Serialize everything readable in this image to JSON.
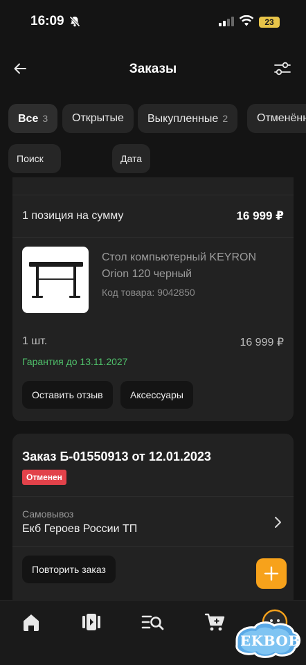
{
  "status_bar": {
    "time": "16:09",
    "battery": "23"
  },
  "header": {
    "title": "Заказы"
  },
  "filters": {
    "chips": [
      {
        "label": "Все",
        "count": "3"
      },
      {
        "label": "Открытые",
        "count": ""
      },
      {
        "label": "Выкупленные",
        "count": "2"
      },
      {
        "label": "Отменённые",
        "count": ""
      }
    ],
    "search_label": "Поиск по заказам",
    "date_label": "Дата"
  },
  "order_1": {
    "summary_label": "1 позиция на сумму",
    "summary_price": "16 999 ₽",
    "product": {
      "name": "Стол компьютерный KEYRON Orion 120 черный",
      "code": "Код товара: 9042850",
      "qty": "1 шт.",
      "price": "16 999 ₽",
      "warranty": "Гарантия до 13.11.2027"
    },
    "buttons": {
      "review": "Оставить отзыв",
      "accessories": "Аксессуары"
    }
  },
  "order_2": {
    "title": "Заказ Б-01550913 от 12.01.2023",
    "status": "Отменен",
    "delivery_type": "Самовывоз",
    "delivery_point": "Екб Героев России ТП",
    "repeat_button": "Повторить заказ"
  },
  "watermark": "EKBOB",
  "colors": {
    "accent": "#f7a21b",
    "success": "#4fbf6a",
    "danger": "#e2424a",
    "background": "#141414",
    "card": "#222222"
  }
}
